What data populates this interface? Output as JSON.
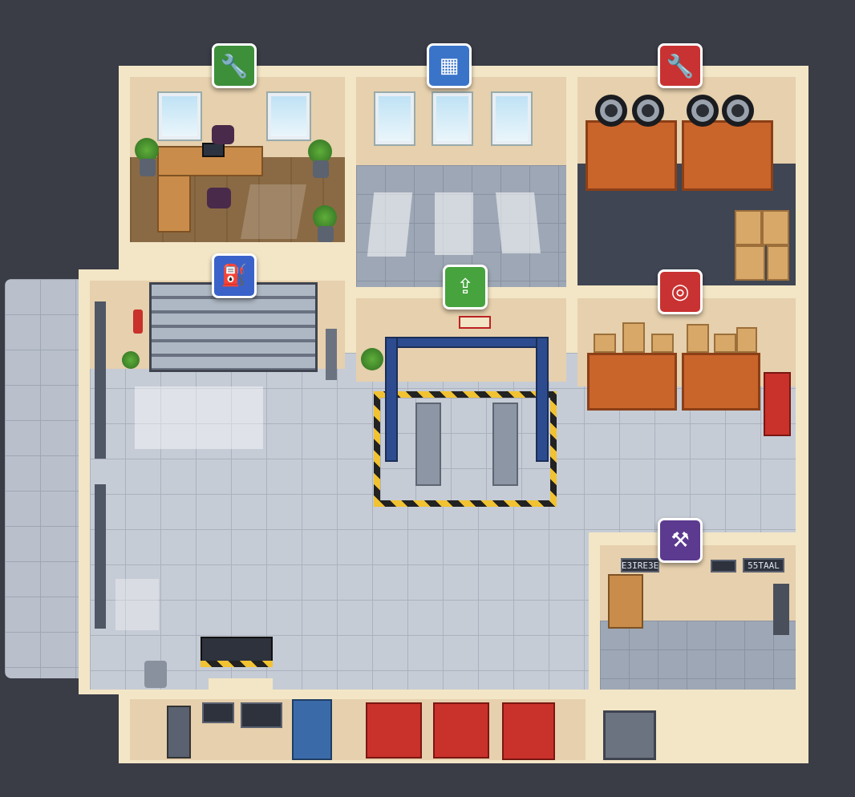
{
  "scene": {
    "background": "#3a3c46",
    "wall_color": "#f3e6c6",
    "floor_color": "#c6ccd6"
  },
  "rooms": [
    {
      "id": "office",
      "icon": "wrench-icon",
      "badge_color": "#3d8f3a"
    },
    {
      "id": "reception",
      "icon": "cash-register-icon",
      "badge_color": "#3a74c9"
    },
    {
      "id": "tire-storage",
      "icon": "wrench-icon",
      "badge_color": "#c93232"
    },
    {
      "id": "garage-entry",
      "icon": "spray-nozzle-icon",
      "badge_color": "#3a62c9"
    },
    {
      "id": "lift-bay",
      "icon": "car-lift-icon",
      "badge_color": "#46a33d"
    },
    {
      "id": "parts-storage",
      "icon": "tire-icon",
      "badge_color": "#c93232"
    },
    {
      "id": "tool-room",
      "icon": "hammer-icon",
      "badge_color": "#5b3a8f"
    }
  ],
  "signs": {
    "lift_sign": "",
    "tool_room_left": "E3IRE3E",
    "tool_room_right": "55TAAL"
  }
}
